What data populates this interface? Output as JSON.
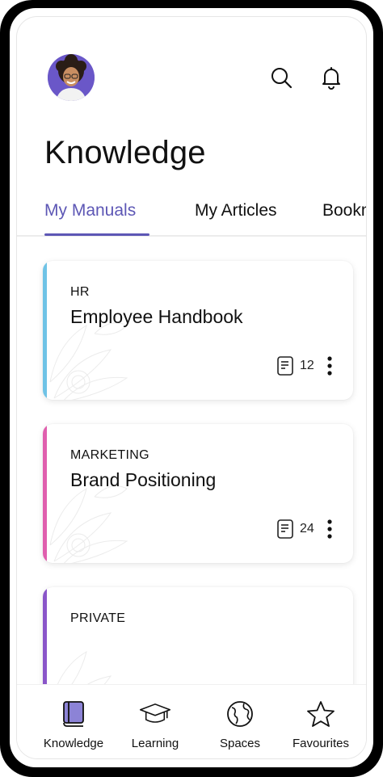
{
  "header": {
    "title": "Knowledge",
    "icons": {
      "avatar": "user-avatar",
      "search": "search-icon",
      "notifications": "bell-icon"
    }
  },
  "tabs": [
    {
      "label": "My Manuals",
      "active": true
    },
    {
      "label": "My Articles",
      "active": false
    },
    {
      "label": "Bookm",
      "active": false
    }
  ],
  "cards": [
    {
      "category": "HR",
      "title": "Employee Handbook",
      "count": "12",
      "accent": "#6fc3e6"
    },
    {
      "category": "MARKETING",
      "title": "Brand Positioning",
      "count": "24",
      "accent": "#e05fae"
    },
    {
      "category": "PRIVATE",
      "title": "",
      "count": "",
      "accent": "#8a56c9"
    }
  ],
  "bottom_nav": [
    {
      "label": "Knowledge",
      "icon": "book-icon",
      "active": true
    },
    {
      "label": "Learning",
      "icon": "graduation-cap-icon",
      "active": false
    },
    {
      "label": "Spaces",
      "icon": "globe-icon",
      "active": false
    },
    {
      "label": "Favourites",
      "icon": "star-icon",
      "active": false
    }
  ],
  "colors": {
    "accent": "#5d57b5",
    "active_icon": "#8c83d6"
  }
}
